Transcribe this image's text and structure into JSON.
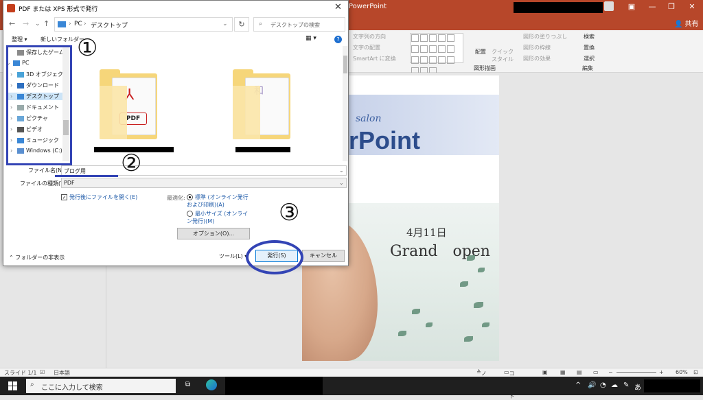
{
  "ppt": {
    "app_title": "PowerPoint",
    "share": "共有",
    "ribbon": {
      "text_direction": "文字列の方向",
      "text_align": "文字の配置",
      "smartart": "SmartArt に変換",
      "arrange": "配置",
      "quick_style": "クイック\nスタイル",
      "fill": "図形の塗りつぶし",
      "outline": "図形の枠線",
      "effect": "図形の効果",
      "drawing_group": "図形描画",
      "find": "検索",
      "replace": "置換",
      "select": "選択",
      "edit_group": "編集"
    },
    "slide": {
      "salon": "salon",
      "title": "owerPoint",
      "date": "4月11日",
      "grand_open": "Grand　open"
    },
    "status": {
      "slide": "スライド 1/1",
      "lang": "日本語",
      "notes": "ノート",
      "comments": "コメント",
      "zoom": "60%"
    }
  },
  "taskbar": {
    "search_placeholder": "ここに入力して検索",
    "ime": "あ"
  },
  "dialog": {
    "title": "PDF または XPS 形式で発行",
    "breadcrumb": [
      "PC",
      "デスクトップ"
    ],
    "search_placeholder": "デスクトップの検索",
    "organize": "整理 ▾",
    "new_folder": "新しいフォルダー",
    "nav_items": [
      {
        "label": "保存したゲーム",
        "icon": "saved-games-icon"
      },
      {
        "label": "PC",
        "icon": "pc-icon"
      },
      {
        "label": "3D オブジェクト",
        "icon": "3d-objects-icon"
      },
      {
        "label": "ダウンロード",
        "icon": "download-icon"
      },
      {
        "label": "デスクトップ",
        "icon": "desktop-icon"
      },
      {
        "label": "ドキュメント",
        "icon": "document-icon"
      },
      {
        "label": "ピクチャ",
        "icon": "pictures-icon"
      },
      {
        "label": "ビデオ",
        "icon": "video-icon"
      },
      {
        "label": "ミュージック",
        "icon": "music-icon"
      },
      {
        "label": "Windows (C:)",
        "icon": "drive-icon"
      }
    ],
    "folder1_glyph": "PDF",
    "folder2_glyph": "和",
    "filename_label": "ファイル名(N):",
    "filename_value": "ブログ用",
    "filetype_label": "ファイルの種類(T):",
    "filetype_value": "PDF",
    "open_after": "発行後にファイルを開く(E)",
    "optimize_label": "最適化:",
    "opt_standard": "標準 (オンライン発行および印刷)(A)",
    "opt_minimum": "最小サイズ (オンライン発行)(M)",
    "options_button": "オプション(O)...",
    "hide_folders": "フォルダーの非表示",
    "tools": "ツール(L)",
    "publish": "発行(S)",
    "cancel": "キャンセル"
  },
  "annotations": {
    "m1": "①",
    "m2": "②",
    "m3": "③",
    "accent": "#3344b5"
  }
}
